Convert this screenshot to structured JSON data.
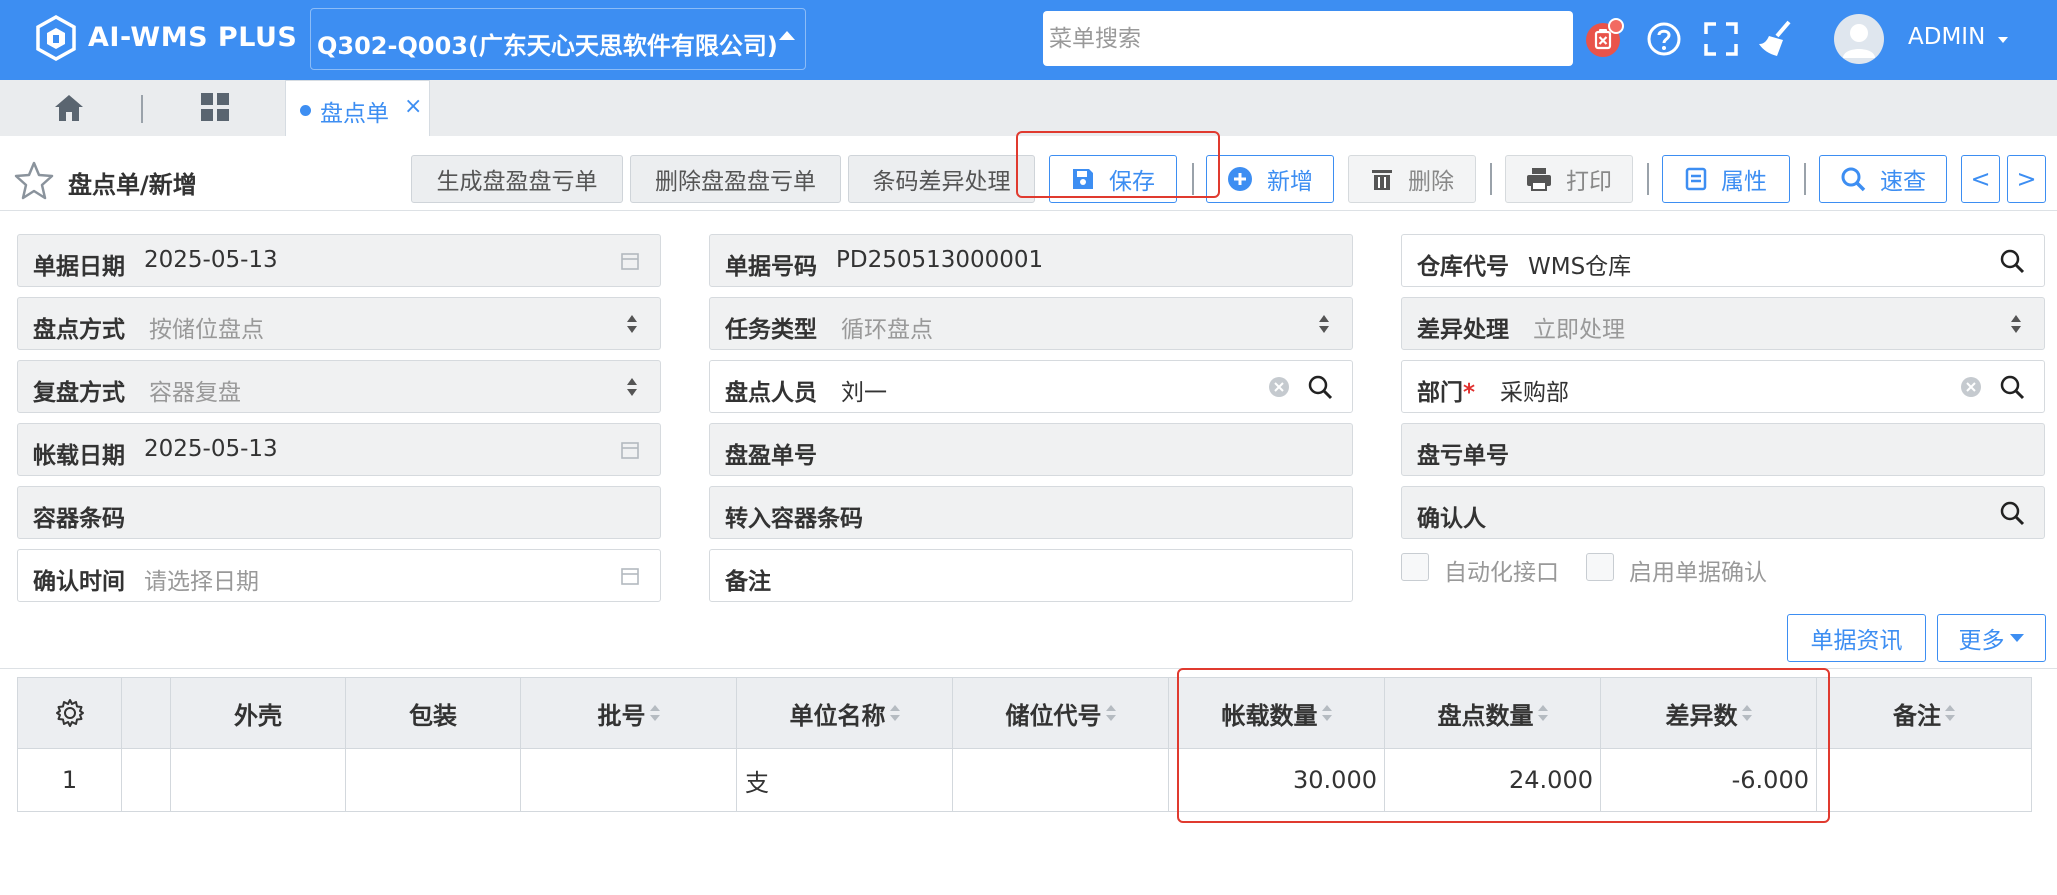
{
  "header": {
    "app_name": "AI-WMS PLUS",
    "company": "Q302-Q003(广东天心天思软件有限公司)",
    "menu_search_placeholder": "菜单搜索",
    "user_name": "ADMIN",
    "icons": [
      "notification-icon",
      "help-icon",
      "fullscreen-icon",
      "clean-icon",
      "user-avatar-icon"
    ]
  },
  "tabs": {
    "active_tab": "盘点单",
    "close_glyph": "×"
  },
  "toolbar": {
    "page_title": "盘点单/新增",
    "gen_profit_loss": "生成盘盈盘亏单",
    "del_profit_loss": "删除盘盈盘亏单",
    "barcode_diff": "条码差异处理",
    "save": "保存",
    "add": "新增",
    "delete": "删除",
    "print": "打印",
    "properties": "属性",
    "quick_search": "速查",
    "prev_glyph": "<",
    "next_glyph": ">"
  },
  "form": {
    "doc_date": {
      "label": "单据日期",
      "value": "2025-05-13"
    },
    "doc_no": {
      "label": "单据号码",
      "value": "PD250513000001"
    },
    "warehouse": {
      "label": "仓库代号",
      "value": "WMS仓库"
    },
    "count_method": {
      "label": "盘点方式",
      "value": "按储位盘点"
    },
    "task_type": {
      "label": "任务类型",
      "value": "循环盘点"
    },
    "diff_handling": {
      "label": "差异处理",
      "value": "立即处理"
    },
    "recount_method": {
      "label": "复盘方式",
      "value": "容器复盘"
    },
    "counter": {
      "label": "盘点人员",
      "value": "刘一"
    },
    "department": {
      "label": "部门",
      "required_mark": "*",
      "value": "采购部"
    },
    "book_date": {
      "label": "帐载日期",
      "value": "2025-05-13"
    },
    "profit_no": {
      "label": "盘盈单号",
      "value": ""
    },
    "loss_no": {
      "label": "盘亏单号",
      "value": ""
    },
    "container_barcode": {
      "label": "容器条码",
      "value": ""
    },
    "transfer_container": {
      "label": "转入容器条码",
      "value": ""
    },
    "confirmer": {
      "label": "确认人",
      "value": ""
    },
    "confirm_time": {
      "label": "确认时间",
      "placeholder": "请选择日期"
    },
    "remark": {
      "label": "备注",
      "value": ""
    },
    "auto_interface": "自动化接口",
    "enable_confirm": "启用单据确认"
  },
  "actions": {
    "doc_info": "单据资讯",
    "more": "更多"
  },
  "table": {
    "columns": [
      "外壳",
      "包装",
      "批号",
      "单位名称",
      "储位代号",
      "帐载数量",
      "盘点数量",
      "差异数",
      "备注"
    ],
    "rows": [
      {
        "no": "1",
        "shell": "",
        "pack": "",
        "batch": "",
        "unit": "支",
        "location": "",
        "book_qty": "30.000",
        "count_qty": "24.000",
        "diff": "-6.000",
        "remark": ""
      }
    ]
  }
}
